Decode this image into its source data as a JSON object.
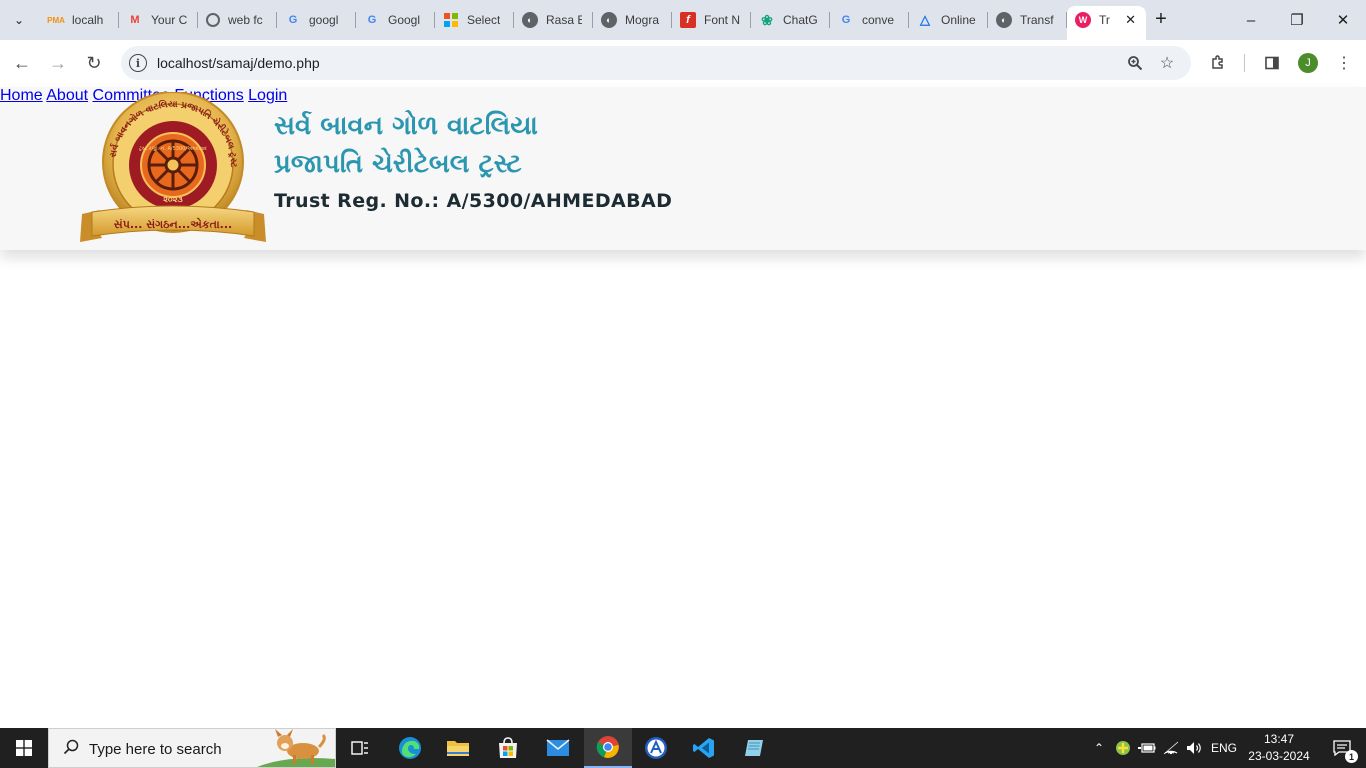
{
  "browser": {
    "tabs": [
      {
        "title": "localh",
        "icon": "phpmyadmin-icon",
        "color": "#f29111",
        "active": false
      },
      {
        "title": "Your C",
        "icon": "gmail-icon",
        "color": "#ea4335",
        "active": false
      },
      {
        "title": "web fc",
        "icon": "google-lens-icon",
        "color": "#5f6368",
        "active": false
      },
      {
        "title": "googl",
        "icon": "google-icon",
        "color": "#4285f4",
        "active": false
      },
      {
        "title": "Googl",
        "icon": "google-icon",
        "color": "#4285f4",
        "active": false
      },
      {
        "title": "Select",
        "icon": "bing-icon",
        "color": "#f25022",
        "active": false
      },
      {
        "title": "Rasa E",
        "icon": "globe-icon",
        "color": "#5f6368",
        "active": false
      },
      {
        "title": "Mogra",
        "icon": "globe-icon",
        "color": "#5f6368",
        "active": false
      },
      {
        "title": "Font N",
        "icon": "fontlibrary-icon",
        "color": "#d93025",
        "active": false
      },
      {
        "title": "ChatG",
        "icon": "chatgpt-icon",
        "color": "#10a37f",
        "active": false
      },
      {
        "title": "conve",
        "icon": "google-icon",
        "color": "#4285f4",
        "active": false
      },
      {
        "title": "Online",
        "icon": "triangle-icon",
        "color": "#1a73e8",
        "active": false
      },
      {
        "title": "Transf",
        "icon": "globe-icon",
        "color": "#5f6368",
        "active": false
      },
      {
        "title": "Tr",
        "icon": "webflow-icon",
        "color": "#e91e63",
        "active": true
      }
    ],
    "url": "localhost/samaj/demo.php",
    "profile_initial": "J"
  },
  "site": {
    "logo_ring_text": "સર્વ બાવનગોળ વાટલિયા પ્રજાપતિ ચેરીટેબલ ટ્રસ્ટ",
    "logo_inner_text": "ટ્રસ્ટ રજી. નં. A/5300/અમદાવાદ",
    "logo_year": "૨૦૨૩",
    "logo_ribbon": "સંપ... સંગઠન...એકતા...",
    "title_line1": "સર્વ બાવન ગોળ વાટલિયા",
    "title_line2": "પ્રજાપતિ ચેરીટેબલ ટ્રસ્ટ",
    "reg_no": "Trust Reg. No.: A/5300/AHMEDABAD",
    "nav": {
      "home": "Home",
      "about": "About",
      "committee": "Committee",
      "functions": "Functions",
      "login": "Login"
    },
    "colors": {
      "title": "#2b96b0",
      "nav": "#103c4e",
      "header_bg": "#f7f7f7"
    }
  },
  "taskbar": {
    "search_placeholder": "Type here to search",
    "language": "ENG",
    "time": "13:47",
    "date": "23-03-2024",
    "notification_count": "1"
  }
}
